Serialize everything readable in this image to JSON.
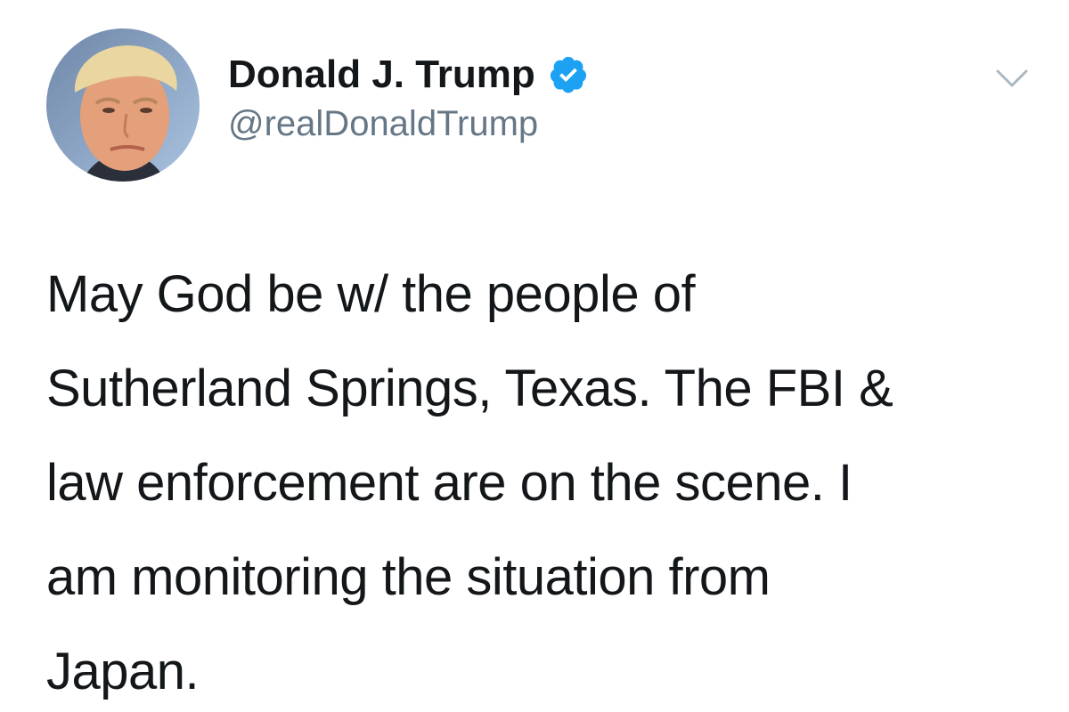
{
  "author": {
    "display_name": "Donald J. Trump",
    "handle": "@realDonaldTrump",
    "verified": true,
    "avatar_icon": "profile-photo",
    "verified_icon": "verified-badge-icon",
    "menu_icon": "chevron-down-icon"
  },
  "tweet": {
    "text": "May God be w/ the people of\nSutherland Springs, Texas. The FBI &\nlaw enforcement are on the scene. I\nam monitoring the situation from\nJapan."
  },
  "colors": {
    "text": "#14171a",
    "handle": "#657786",
    "verified_blue": "#1da1f2",
    "chevron": "#aab8c2",
    "background": "#ffffff"
  }
}
